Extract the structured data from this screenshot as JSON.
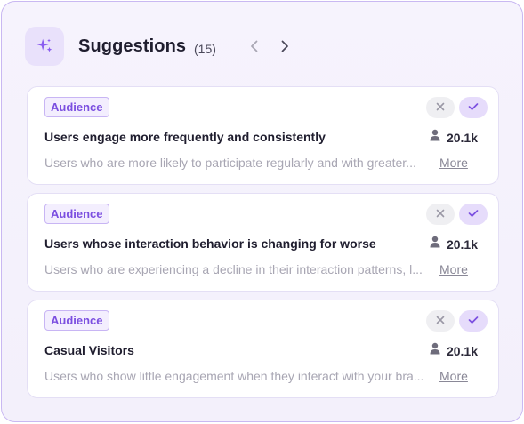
{
  "header": {
    "title": "Suggestions",
    "count": "(15)",
    "icon": "sparkles-icon",
    "nav_prev_icon": "chevron-left-icon",
    "nav_next_icon": "chevron-right-icon"
  },
  "colors": {
    "accent": "#7b4fe0",
    "panel_border": "#c9b8f2",
    "panel_bg": "#f4f1fc"
  },
  "suggestions": [
    {
      "badge": "Audience",
      "title": "Users engage more frequently and consistently",
      "audience_size": "20.1k",
      "description": "Users who are more likely to participate regularly and with greater...",
      "more_label": "More"
    },
    {
      "badge": "Audience",
      "title": "Users whose interaction behavior is changing for worse",
      "audience_size": "20.1k",
      "description": "Users who are experiencing a decline in their interaction patterns, l...",
      "more_label": "More"
    },
    {
      "badge": "Audience",
      "title": "Casual Visitors",
      "audience_size": "20.1k",
      "description": "Users who show little engagement when they interact with your bra...",
      "more_label": "More"
    }
  ]
}
